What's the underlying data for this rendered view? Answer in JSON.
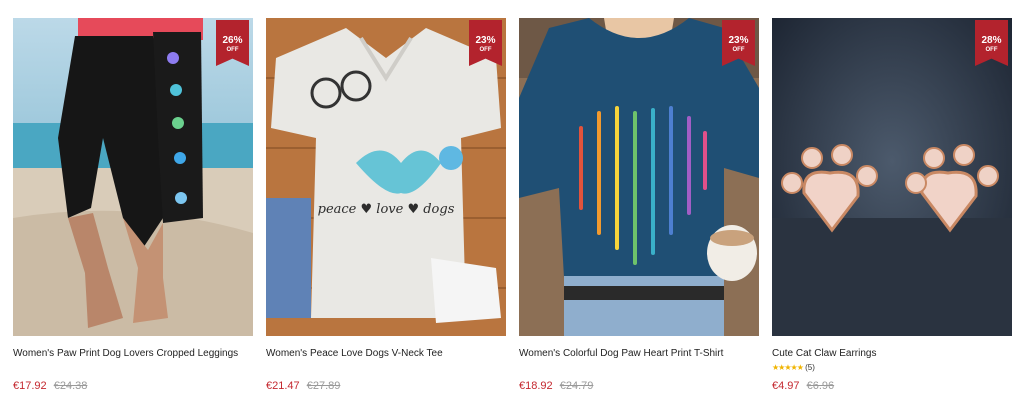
{
  "products": [
    {
      "title": "Women's Paw Print Dog Lovers Cropped Leggings",
      "price": "€17.92",
      "original_price": "€24.38",
      "discount": "26%",
      "discount_suffix": "OFF"
    },
    {
      "title": "Women's Peace Love Dogs V-Neck Tee",
      "price": "€21.47",
      "original_price": "€27.89",
      "discount": "23%",
      "discount_suffix": "OFF",
      "shirt_text": "peace ♥ love ♥ dogs"
    },
    {
      "title": "Women's Colorful Dog Paw Heart Print T-Shirt",
      "price": "€18.92",
      "original_price": "€24.79",
      "discount": "23%",
      "discount_suffix": "OFF"
    },
    {
      "title": "Cute Cat Claw Earrings",
      "price": "€4.97",
      "original_price": "€6.96",
      "discount": "28%",
      "discount_suffix": "OFF",
      "stars": "★★★★★",
      "review_count": "(5)"
    }
  ],
  "colors": {
    "sale_price": "#c4282f",
    "badge": "#b3232d",
    "star": "#f0b400"
  }
}
